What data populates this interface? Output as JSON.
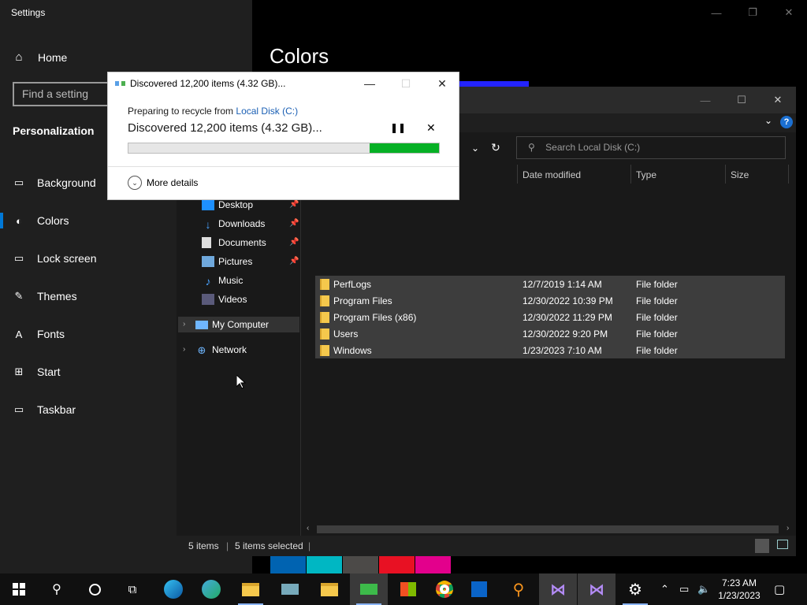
{
  "settings": {
    "title": "Settings",
    "home": "Home",
    "search_placeholder": "Find a setting",
    "section": "Personalization",
    "nav": [
      {
        "label": "Background",
        "icon": "image-icon"
      },
      {
        "label": "Colors",
        "icon": "palette-icon",
        "active": true
      },
      {
        "label": "Lock screen",
        "icon": "lock-screen-icon"
      },
      {
        "label": "Themes",
        "icon": "brush-icon"
      },
      {
        "label": "Fonts",
        "icon": "font-icon"
      },
      {
        "label": "Start",
        "icon": "start-icon"
      },
      {
        "label": "Taskbar",
        "icon": "taskbar-icon"
      }
    ],
    "page_title": "Colors"
  },
  "dialog": {
    "title": "Discovered 12,200 items (4.32 GB)...",
    "preparing_prefix": "Preparing to recycle from ",
    "preparing_link": "Local Disk (C:)",
    "status": "Discovered 12,200 items (4.32 GB)...",
    "progress_fraction": 0.11,
    "more_details": "More details"
  },
  "explorer": {
    "search_placeholder": "Search Local Disk (C:)",
    "columns": [
      "Date modified",
      "Type",
      "Size"
    ],
    "quick_access": [
      {
        "label": "Desktop",
        "pinned": true
      },
      {
        "label": "Downloads",
        "pinned": true
      },
      {
        "label": "Documents",
        "pinned": true
      },
      {
        "label": "Pictures",
        "pinned": true
      },
      {
        "label": "Music",
        "pinned": false
      },
      {
        "label": "Videos",
        "pinned": false
      }
    ],
    "tree": [
      "My Computer",
      "Network"
    ],
    "rows": [
      {
        "name": "PerfLogs",
        "date": "12/7/2019 1:14 AM",
        "type": "File folder"
      },
      {
        "name": "Program Files",
        "date": "12/30/2022 10:39 PM",
        "type": "File folder"
      },
      {
        "name": "Program Files (x86)",
        "date": "12/30/2022 11:29 PM",
        "type": "File folder"
      },
      {
        "name": "Users",
        "date": "12/30/2022 9:20 PM",
        "type": "File folder"
      },
      {
        "name": "Windows",
        "date": "1/23/2023 7:10 AM",
        "type": "File folder"
      }
    ],
    "status_items": "5 items",
    "status_selected": "5 items selected"
  },
  "swatches": [
    "#0063b1",
    "#00b7c3",
    "#4c4a48",
    "#e81123",
    "#e3008c"
  ],
  "taskbar": {
    "time": "7:23 AM",
    "date": "1/23/2023"
  },
  "colors": {
    "accent": "#0078d7",
    "progress": "#06b025"
  }
}
